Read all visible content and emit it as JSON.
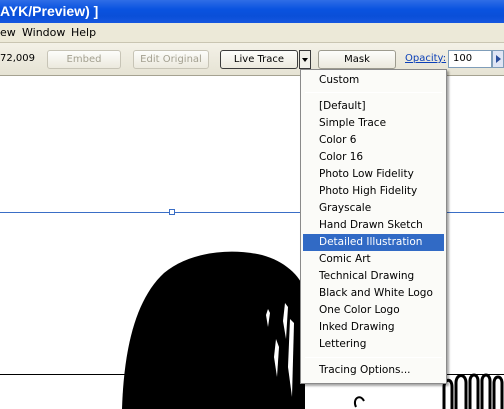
{
  "window": {
    "title": "AYK/Preview) ]"
  },
  "menubar": {
    "items": [
      {
        "label": "ew"
      },
      {
        "label": "Window"
      },
      {
        "label": "Help"
      }
    ]
  },
  "toolbar": {
    "coord_text": "72,009",
    "embed_label": "Embed",
    "edit_original_label": "Edit Original",
    "live_trace_label": "Live Trace",
    "mask_label": "Mask",
    "opacity_label": "Opacity:",
    "opacity_value": "100"
  },
  "trace_menu": {
    "items": [
      {
        "label": "Custom"
      },
      {
        "label": "[Default]"
      },
      {
        "label": "Simple Trace"
      },
      {
        "label": "Color 6"
      },
      {
        "label": "Color 16"
      },
      {
        "label": "Photo Low Fidelity"
      },
      {
        "label": "Photo High Fidelity"
      },
      {
        "label": "Grayscale"
      },
      {
        "label": "Hand Drawn Sketch"
      },
      {
        "label": "Detailed Illustration",
        "selected": true
      },
      {
        "label": "Comic Art"
      },
      {
        "label": "Technical Drawing"
      },
      {
        "label": "Black and White Logo"
      },
      {
        "label": "One Color Logo"
      },
      {
        "label": "Inked Drawing"
      },
      {
        "label": "Lettering"
      },
      {
        "label": "Tracing Options..."
      }
    ]
  },
  "colors": {
    "titlebar": "#0a4fd8",
    "menu_highlight": "#316ac5",
    "guide": "#3a6ec6"
  }
}
